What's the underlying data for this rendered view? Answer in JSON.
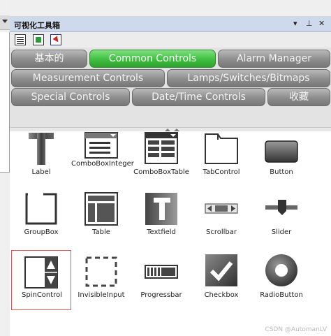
{
  "panel": {
    "title": "可视化工具箱",
    "controls": {
      "menu": "▾",
      "pin": "⊥",
      "close": "✕"
    }
  },
  "toolbar": {
    "buttons": [
      "document-list-icon",
      "green-block-icon",
      "pointer-icon"
    ]
  },
  "tabs": [
    {
      "label": "基本的",
      "active": false
    },
    {
      "label": "Common Controls",
      "active": true
    },
    {
      "label": "Alarm Manager",
      "active": false
    },
    {
      "label": "Measurement Controls",
      "active": false
    },
    {
      "label": "Lamps/Switches/Bitmaps",
      "active": false
    },
    {
      "label": "Special Controls",
      "active": false
    },
    {
      "label": "Date/Time Controls",
      "active": false
    },
    {
      "label": "收藏",
      "active": false
    }
  ],
  "items": [
    {
      "label": "Label",
      "icon": "label-icon"
    },
    {
      "label": "ComboBoxInteger",
      "icon": "combobox-integer-icon"
    },
    {
      "label": "ComboBoxTable",
      "icon": "combobox-table-icon"
    },
    {
      "label": "TabControl",
      "icon": "tab-control-icon"
    },
    {
      "label": "Button",
      "icon": "button-icon"
    },
    {
      "label": "GroupBox",
      "icon": "groupbox-icon"
    },
    {
      "label": "Table",
      "icon": "table-icon"
    },
    {
      "label": "Textfield",
      "icon": "textfield-icon"
    },
    {
      "label": "Scrollbar",
      "icon": "scrollbar-icon"
    },
    {
      "label": "Slider",
      "icon": "slider-icon"
    },
    {
      "label": "SpinControl",
      "icon": "spin-control-icon",
      "selected": true
    },
    {
      "label": "InvisibleInput",
      "icon": "invisible-input-icon"
    },
    {
      "label": "Progressbar",
      "icon": "progressbar-icon"
    },
    {
      "label": "Checkbox",
      "icon": "checkbox-icon"
    },
    {
      "label": "RadioButton",
      "icon": "radio-button-icon"
    }
  ],
  "watermark": "CSDN @AutomanLV"
}
